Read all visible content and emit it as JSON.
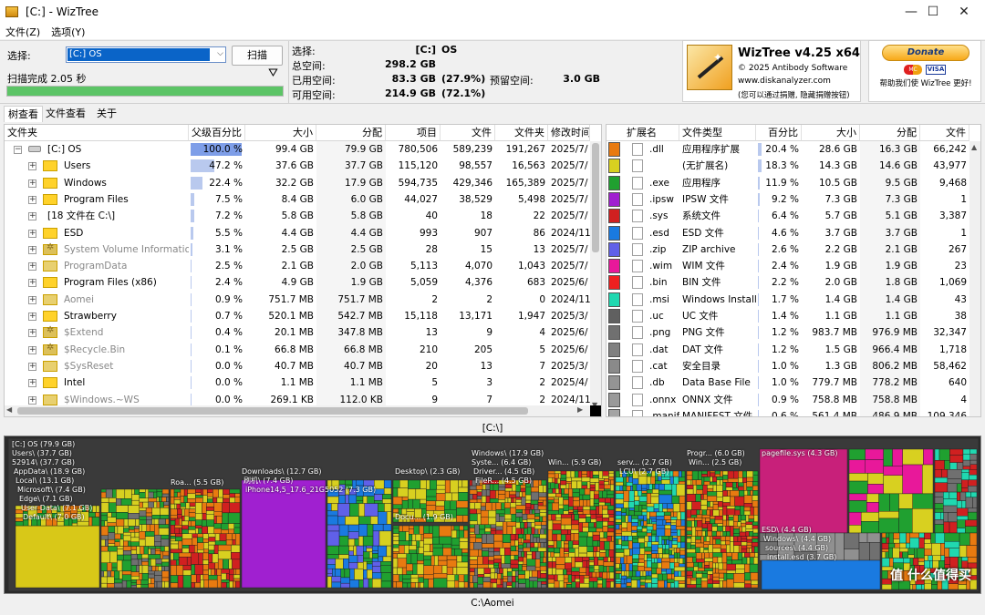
{
  "window": {
    "title": "[C:]  - WizTree"
  },
  "menu": [
    "文件(Z)",
    "选项(Y)"
  ],
  "top": {
    "select_label": "选择:",
    "drive_value": "[C:] OS",
    "scan_button": "扫描",
    "scan_status": "扫描完成 2.05 秒",
    "progress": 1.0,
    "stats": {
      "select_label": "选择:",
      "select_value": "[C:]",
      "select_name": "OS",
      "total_label": "总空间:",
      "total_value": "298.2 GB",
      "used_label": "已用空间:",
      "used_value": "83.3 GB",
      "used_pct": "(27.9%)",
      "free_label": "可用空间:",
      "free_value": "214.9 GB",
      "free_pct": "(72.1%)",
      "reserved_label": "预留空间:",
      "reserved_value": "3.0 GB"
    },
    "logo": {
      "name": "WizTree v4.25 x64",
      "copyright": "© 2025 Antibody Software",
      "url": "www.diskanalyzer.com",
      "note": "(您可以通过捐赠, 隐藏捐赠按钮)"
    },
    "donate": {
      "button": "Donate",
      "card_mc": "MC",
      "card_visa": "VISA",
      "text": "帮助我们使 WizTree 更好!"
    }
  },
  "tabs": [
    "树查看",
    "文件查看",
    "关于"
  ],
  "tree": {
    "columns": [
      "文件夹",
      "父级百分比",
      "大小",
      "分配",
      "项目",
      "文件",
      "文件夹",
      "修改时间"
    ],
    "rows": [
      {
        "name": "[C:] OS",
        "pct": "100.0 %",
        "pctv": 100.0,
        "size": "99.4 GB",
        "alloc": "79.9 GB",
        "items": "780,506",
        "files": "589,239",
        "folders": "191,267",
        "date": "2025/7/",
        "type": "drive",
        "level": 0,
        "exp": "−"
      },
      {
        "name": "Users",
        "pct": "47.2 %",
        "pctv": 47.2,
        "size": "37.6 GB",
        "alloc": "37.7 GB",
        "items": "115,120",
        "files": "98,557",
        "folders": "16,563",
        "date": "2025/7/",
        "type": "folder",
        "level": 1,
        "exp": "+"
      },
      {
        "name": "Windows",
        "pct": "22.4 %",
        "pctv": 22.4,
        "size": "32.2 GB",
        "alloc": "17.9 GB",
        "items": "594,735",
        "files": "429,346",
        "folders": "165,389",
        "date": "2025/7/",
        "type": "folder",
        "level": 1,
        "exp": "+"
      },
      {
        "name": "Program Files",
        "pct": "7.5 %",
        "pctv": 7.5,
        "size": "8.4 GB",
        "alloc": "6.0 GB",
        "items": "44,027",
        "files": "38,529",
        "folders": "5,498",
        "date": "2025/7/",
        "type": "folder",
        "level": 1,
        "exp": "+"
      },
      {
        "name": "[18 文件在 C:\\]",
        "pct": "7.2 %",
        "pctv": 7.2,
        "size": "5.8 GB",
        "alloc": "5.8 GB",
        "items": "40",
        "files": "18",
        "folders": "22",
        "date": "2025/7/",
        "type": "none",
        "level": 1,
        "exp": "+"
      },
      {
        "name": "ESD",
        "pct": "5.5 %",
        "pctv": 5.5,
        "size": "4.4 GB",
        "alloc": "4.4 GB",
        "items": "993",
        "files": "907",
        "folders": "86",
        "date": "2024/11",
        "type": "folder",
        "level": 1,
        "exp": "+"
      },
      {
        "name": "System Volume Information",
        "pct": "3.1 %",
        "pctv": 3.1,
        "size": "2.5 GB",
        "alloc": "2.5 GB",
        "items": "28",
        "files": "15",
        "folders": "13",
        "date": "2025/7/",
        "type": "gear",
        "level": 1,
        "exp": "+",
        "gray": true
      },
      {
        "name": "ProgramData",
        "pct": "2.5 %",
        "pctv": 2.5,
        "size": "2.1 GB",
        "alloc": "2.0 GB",
        "items": "5,113",
        "files": "4,070",
        "folders": "1,043",
        "date": "2025/7/",
        "type": "sys",
        "level": 1,
        "exp": "+",
        "gray": true
      },
      {
        "name": "Program Files (x86)",
        "pct": "2.4 %",
        "pctv": 2.4,
        "size": "4.9 GB",
        "alloc": "1.9 GB",
        "items": "5,059",
        "files": "4,376",
        "folders": "683",
        "date": "2025/6/",
        "type": "folder",
        "level": 1,
        "exp": "+"
      },
      {
        "name": "Aomei",
        "pct": "0.9 %",
        "pctv": 0.9,
        "size": "751.7 MB",
        "alloc": "751.7 MB",
        "items": "2",
        "files": "2",
        "folders": "0",
        "date": "2024/11",
        "type": "sys",
        "level": 1,
        "exp": "+",
        "gray": true
      },
      {
        "name": "Strawberry",
        "pct": "0.7 %",
        "pctv": 0.7,
        "size": "520.1 MB",
        "alloc": "542.7 MB",
        "items": "15,118",
        "files": "13,171",
        "folders": "1,947",
        "date": "2025/3/",
        "type": "folder",
        "level": 1,
        "exp": "+"
      },
      {
        "name": "$Extend",
        "pct": "0.4 %",
        "pctv": 0.4,
        "size": "20.1 MB",
        "alloc": "347.8 MB",
        "items": "13",
        "files": "9",
        "folders": "4",
        "date": "2025/6/",
        "type": "gear",
        "level": 1,
        "exp": "+",
        "gray": true
      },
      {
        "name": "$Recycle.Bin",
        "pct": "0.1 %",
        "pctv": 0.1,
        "size": "66.8 MB",
        "alloc": "66.8 MB",
        "items": "210",
        "files": "205",
        "folders": "5",
        "date": "2025/6/",
        "type": "gear",
        "level": 1,
        "exp": "+",
        "gray": true
      },
      {
        "name": "$SysReset",
        "pct": "0.0 %",
        "pctv": 0.0,
        "size": "40.7 MB",
        "alloc": "40.7 MB",
        "items": "20",
        "files": "13",
        "folders": "7",
        "date": "2025/3/",
        "type": "sys",
        "level": 1,
        "exp": "+",
        "gray": true
      },
      {
        "name": "Intel",
        "pct": "0.0 %",
        "pctv": 0.0,
        "size": "1.1 MB",
        "alloc": "1.1 MB",
        "items": "5",
        "files": "3",
        "folders": "2",
        "date": "2025/4/",
        "type": "folder",
        "level": 1,
        "exp": "+"
      },
      {
        "name": "$Windows.~WS",
        "pct": "0.0 %",
        "pctv": 0.0,
        "size": "269.1 KB",
        "alloc": "112.0 KB",
        "items": "9",
        "files": "7",
        "folders": "2",
        "date": "2024/11",
        "type": "sys",
        "level": 1,
        "exp": "+",
        "gray": true
      }
    ]
  },
  "exts": {
    "columns": [
      "扩展名",
      "文件类型",
      "百分比",
      "大小",
      "分配",
      "文件"
    ],
    "rows": [
      {
        "color": "#e87a10",
        "ext": ".dll",
        "type": "应用程序扩展",
        "pct": "20.4 %",
        "pctv": 20.4,
        "size": "28.6 GB",
        "alloc": "16.3 GB",
        "files": "66,242"
      },
      {
        "color": "#d8d020",
        "ext": "",
        "type": "(无扩展名)",
        "pct": "18.3 %",
        "pctv": 18.3,
        "size": "14.3 GB",
        "alloc": "14.6 GB",
        "files": "43,977"
      },
      {
        "color": "#20a030",
        "ext": ".exe",
        "type": "应用程序",
        "pct": "11.9 %",
        "pctv": 11.9,
        "size": "10.5 GB",
        "alloc": "9.5 GB",
        "files": "9,468"
      },
      {
        "color": "#a020d0",
        "ext": ".ipsw",
        "type": "IPSW 文件",
        "pct": "9.2 %",
        "pctv": 9.2,
        "size": "7.3 GB",
        "alloc": "7.3 GB",
        "files": "1"
      },
      {
        "color": "#d02020",
        "ext": ".sys",
        "type": "系统文件",
        "pct": "6.4 %",
        "pctv": 6.4,
        "size": "5.7 GB",
        "alloc": "5.1 GB",
        "files": "3,387"
      },
      {
        "color": "#1a7ae0",
        "ext": ".esd",
        "type": "ESD 文件",
        "pct": "4.6 %",
        "pctv": 4.6,
        "size": "3.7 GB",
        "alloc": "3.7 GB",
        "files": "1"
      },
      {
        "color": "#6060e8",
        "ext": ".zip",
        "type": "ZIP archive",
        "pct": "2.6 %",
        "pctv": 2.6,
        "size": "2.2 GB",
        "alloc": "2.1 GB",
        "files": "267"
      },
      {
        "color": "#e8189a",
        "ext": ".wim",
        "type": "WIM 文件",
        "pct": "2.4 %",
        "pctv": 2.4,
        "size": "1.9 GB",
        "alloc": "1.9 GB",
        "files": "23"
      },
      {
        "color": "#ee2020",
        "ext": ".bin",
        "type": "BIN 文件",
        "pct": "2.2 %",
        "pctv": 2.2,
        "size": "2.0 GB",
        "alloc": "1.8 GB",
        "files": "1,069"
      },
      {
        "color": "#20d8b0",
        "ext": ".msi",
        "type": "Windows Installe",
        "pct": "1.7 %",
        "pctv": 1.7,
        "size": "1.4 GB",
        "alloc": "1.4 GB",
        "files": "43"
      },
      {
        "color": "#606060",
        "ext": ".uc",
        "type": "UC 文件",
        "pct": "1.4 %",
        "pctv": 1.4,
        "size": "1.1 GB",
        "alloc": "1.1 GB",
        "files": "38"
      },
      {
        "color": "#707070",
        "ext": ".png",
        "type": "PNG 文件",
        "pct": "1.2 %",
        "pctv": 1.2,
        "size": "983.7 MB",
        "alloc": "976.9 MB",
        "files": "32,347"
      },
      {
        "color": "#808080",
        "ext": ".dat",
        "type": "DAT 文件",
        "pct": "1.2 %",
        "pctv": 1.2,
        "size": "1.5 GB",
        "alloc": "966.4 MB",
        "files": "1,718"
      },
      {
        "color": "#8a8a8a",
        "ext": ".cat",
        "type": "安全目录",
        "pct": "1.0 %",
        "pctv": 1.0,
        "size": "1.3 GB",
        "alloc": "806.2 MB",
        "files": "58,462"
      },
      {
        "color": "#949494",
        "ext": ".db",
        "type": "Data Base File",
        "pct": "1.0 %",
        "pctv": 1.0,
        "size": "779.7 MB",
        "alloc": "778.2 MB",
        "files": "640"
      },
      {
        "color": "#9a9a9a",
        "ext": ".onnx",
        "type": "ONNX 文件",
        "pct": "0.9 %",
        "pctv": 0.9,
        "size": "758.8 MB",
        "alloc": "758.8 MB",
        "files": "4"
      },
      {
        "color": "#a4a4a4",
        "ext": ".manif",
        "type": "MANIFEST 文件",
        "pct": "0.6 %",
        "pctv": 0.6,
        "size": "561.4 MB",
        "alloc": "486.9 MB",
        "files": "109,346"
      }
    ]
  },
  "path_top": "[C:\\]",
  "path_bottom": "C:\\Aomei",
  "watermark": "值 什么值得买",
  "chart_data": {
    "type": "treemap",
    "labels": [
      "[C:] OS  (79.9 GB)",
      "Users\\ (37.7 GB)",
      "52914\\ (37.7 GB)",
      "AppData\\ (18.9 GB)",
      "Local\\ (13.1 GB)",
      "Microsoft\\ (7.4 GB)",
      "Edge\\ (7.1 GB)",
      "User Data\\ (7.1 GB)",
      "Default\\ (7.0 GB)",
      "Roa... (5.5 GB)",
      "Downloads\\ (12.7 GB)",
      "刷机\\ (7.4 GB)",
      "iPhone14,5_17.6_21G5052 (7.3 GB)",
      "Desktop\\ (2.3 GB)",
      "Docu... (1.9 GB)",
      "Windows\\ (17.9 GB)",
      "Syste... (6.4 GB)",
      "Driver... (4.5 GB)",
      "FileR... (4.5 GB)",
      "Win... (5.9 GB)",
      "serv... (2.7 GB)",
      "LCU\\ (2.7 GB)",
      "Progr... (6.0 GB)",
      "Win... (2.5 GB)",
      "pagefile.sys (4.3 GB)",
      "ESD\\ (4.4 GB)",
      "Windows\\ (4.4 GB)",
      "sources\\ (4.4 GB)",
      "install.esd (3.7 GB)"
    ]
  }
}
